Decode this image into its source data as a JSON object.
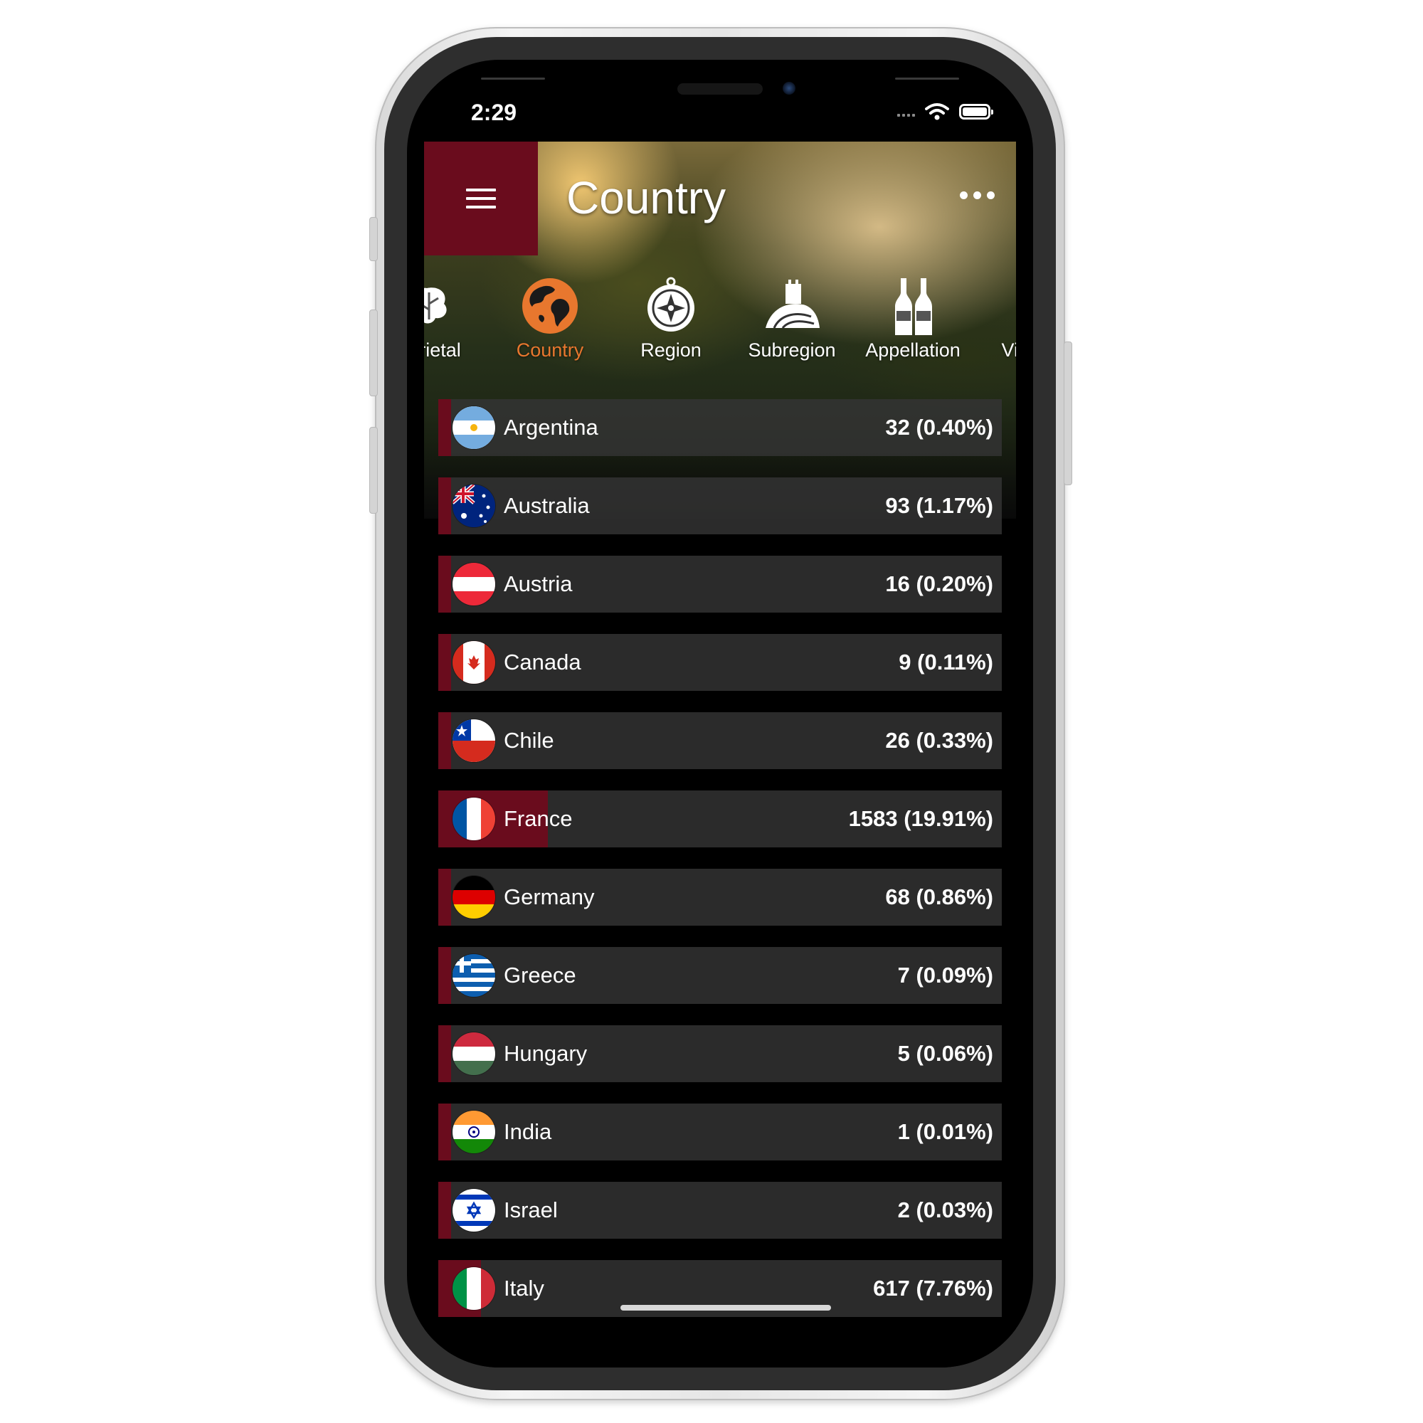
{
  "status_bar": {
    "time": "2:29"
  },
  "header": {
    "title": "Country"
  },
  "tabs": [
    {
      "label": "Varietal",
      "icon": "grape-leaf-icon",
      "active": false
    },
    {
      "label": "Country",
      "icon": "globe-icon",
      "active": true
    },
    {
      "label": "Region",
      "icon": "compass-icon",
      "active": false
    },
    {
      "label": "Subregion",
      "icon": "vineyard-icon",
      "active": false
    },
    {
      "label": "Appellation",
      "icon": "wine-bottles-icon",
      "active": false
    },
    {
      "label": "Vintage",
      "icon": "wine-glass-icon",
      "active": false
    }
  ],
  "countries": [
    {
      "name": "Argentina",
      "count": "32 (0.40%)",
      "share": 0.4,
      "flag": "argentina-flag-icon"
    },
    {
      "name": "Australia",
      "count": "93 (1.17%)",
      "share": 1.17,
      "flag": "australia-flag-icon"
    },
    {
      "name": "Austria",
      "count": "16 (0.20%)",
      "share": 0.2,
      "flag": "austria-flag-icon"
    },
    {
      "name": "Canada",
      "count": "9 (0.11%)",
      "share": 0.11,
      "flag": "canada-flag-icon"
    },
    {
      "name": "Chile",
      "count": "26 (0.33%)",
      "share": 0.33,
      "flag": "chile-flag-icon"
    },
    {
      "name": "France",
      "count": "1583 (19.91%)",
      "share": 19.91,
      "flag": "france-flag-icon"
    },
    {
      "name": "Germany",
      "count": "68 (0.86%)",
      "share": 0.86,
      "flag": "germany-flag-icon"
    },
    {
      "name": "Greece",
      "count": "7 (0.09%)",
      "share": 0.09,
      "flag": "greece-flag-icon"
    },
    {
      "name": "Hungary",
      "count": "5 (0.06%)",
      "share": 0.06,
      "flag": "hungary-flag-icon"
    },
    {
      "name": "India",
      "count": "1 (0.01%)",
      "share": 0.01,
      "flag": "india-flag-icon"
    },
    {
      "name": "Israel",
      "count": "2 (0.03%)",
      "share": 0.03,
      "flag": "israel-flag-icon"
    },
    {
      "name": "Italy",
      "count": "617 (7.76%)",
      "share": 7.76,
      "flag": "italy-flag-icon"
    }
  ],
  "colors": {
    "brand": "#6a0c1d",
    "active_tab": "#e8772e",
    "row_bg": "#343434"
  }
}
